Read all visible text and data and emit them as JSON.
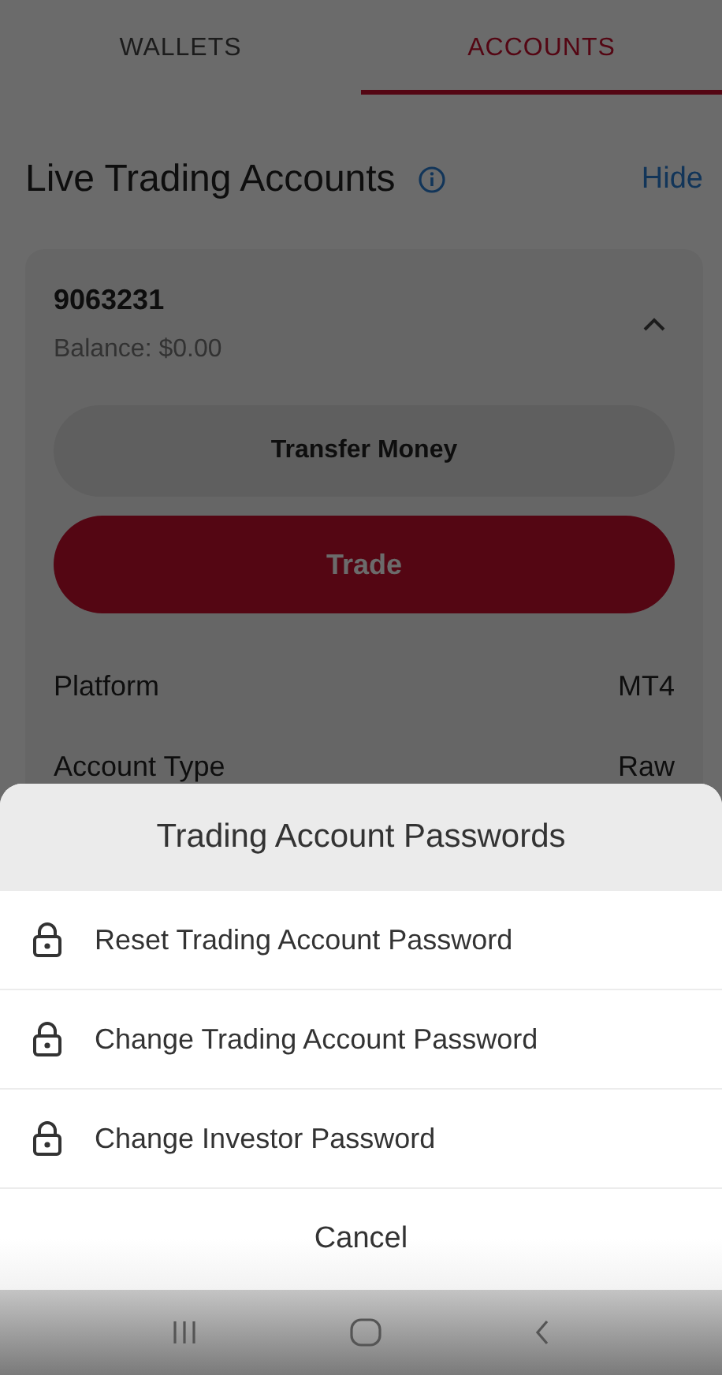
{
  "tabs": [
    {
      "label": "WALLETS",
      "selected": false
    },
    {
      "label": "ACCOUNTS",
      "selected": true
    }
  ],
  "section": {
    "title": "Live Trading Accounts",
    "action": "Hide"
  },
  "account": {
    "number": "9063231",
    "balance": "Balance: $0.00",
    "expanded": true,
    "buttons": [
      {
        "label": "Transfer Money",
        "kind": "secondary"
      },
      {
        "label": "Trade",
        "kind": "primary"
      }
    ],
    "details": [
      {
        "label": "Platform",
        "value": "MT4"
      },
      {
        "label": "Account Type",
        "value": "Raw"
      }
    ]
  },
  "sheet": {
    "title": "Trading Account Passwords",
    "items": [
      {
        "label": "Reset Trading Account Password"
      },
      {
        "label": "Change Trading Account Password"
      },
      {
        "label": "Change Investor Password"
      }
    ],
    "cancel": "Cancel"
  }
}
